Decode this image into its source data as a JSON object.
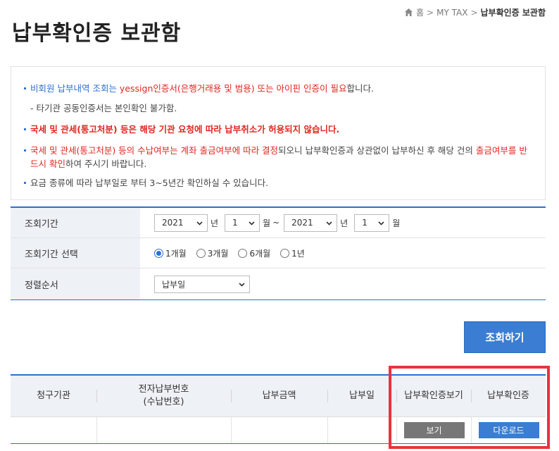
{
  "breadcrumb": {
    "home": "홈",
    "section": "MY TAX",
    "current": "납부확인증 보관함",
    "sep": ">"
  },
  "page_title": "납부확인증 보관함",
  "notice": {
    "line1_a": "비회원 납부내역 조회는 ",
    "line1_b": "yessign인증서(은행거래용 및 범용) 또는 아이핀 인증이 필요",
    "line1_c": "합니다.",
    "line2": "- 타기관 공동인증서는 본인확인 불가함.",
    "line3": "국세 및 관세(통고처분) 등은 해당 기관 요청에 따라 납부취소가 허용되지 않습니다.",
    "line4_a": "국세 및 관세(통고처분) 등의 수납여부는 계좌 출금여부에 따라 결정",
    "line4_b": "되오니 납부확인증과 상관없이 납부하신 후 해당 건의 ",
    "line4_c": "출금여부를 반드시 확인",
    "line4_d": "하여 주시기 바랍니다.",
    "line5": "요금 종류에 따라 납부일로 부터 3~5년간 확인하실 수 있습니다."
  },
  "form": {
    "period_label": "조회기간",
    "start_year": "2021",
    "start_month": "1",
    "end_year": "2021",
    "end_month": "1",
    "year_unit": "년",
    "month_unit": "월",
    "range_sep": "~",
    "period_select_label": "조회기간 선택",
    "radios": [
      "1개월",
      "3개월",
      "6개월",
      "1년"
    ],
    "radio_selected": "1개월",
    "order_label": "정렬순서",
    "order_value": "납부일"
  },
  "search_button": "조회하기",
  "result_table": {
    "headers": {
      "agency": "청구기관",
      "epay_no_1": "전자납부번호",
      "epay_no_2": "(수납번호)",
      "amount": "납부금액",
      "date": "납부일",
      "view": "납부확인증보기",
      "cert": "납부확인증"
    },
    "row": {
      "view_button": "보기",
      "download_button": "다운로드"
    }
  },
  "colors": {
    "accent": "#2e6fd1",
    "highlight": "#e8343a",
    "red_text": "#e0261f"
  }
}
